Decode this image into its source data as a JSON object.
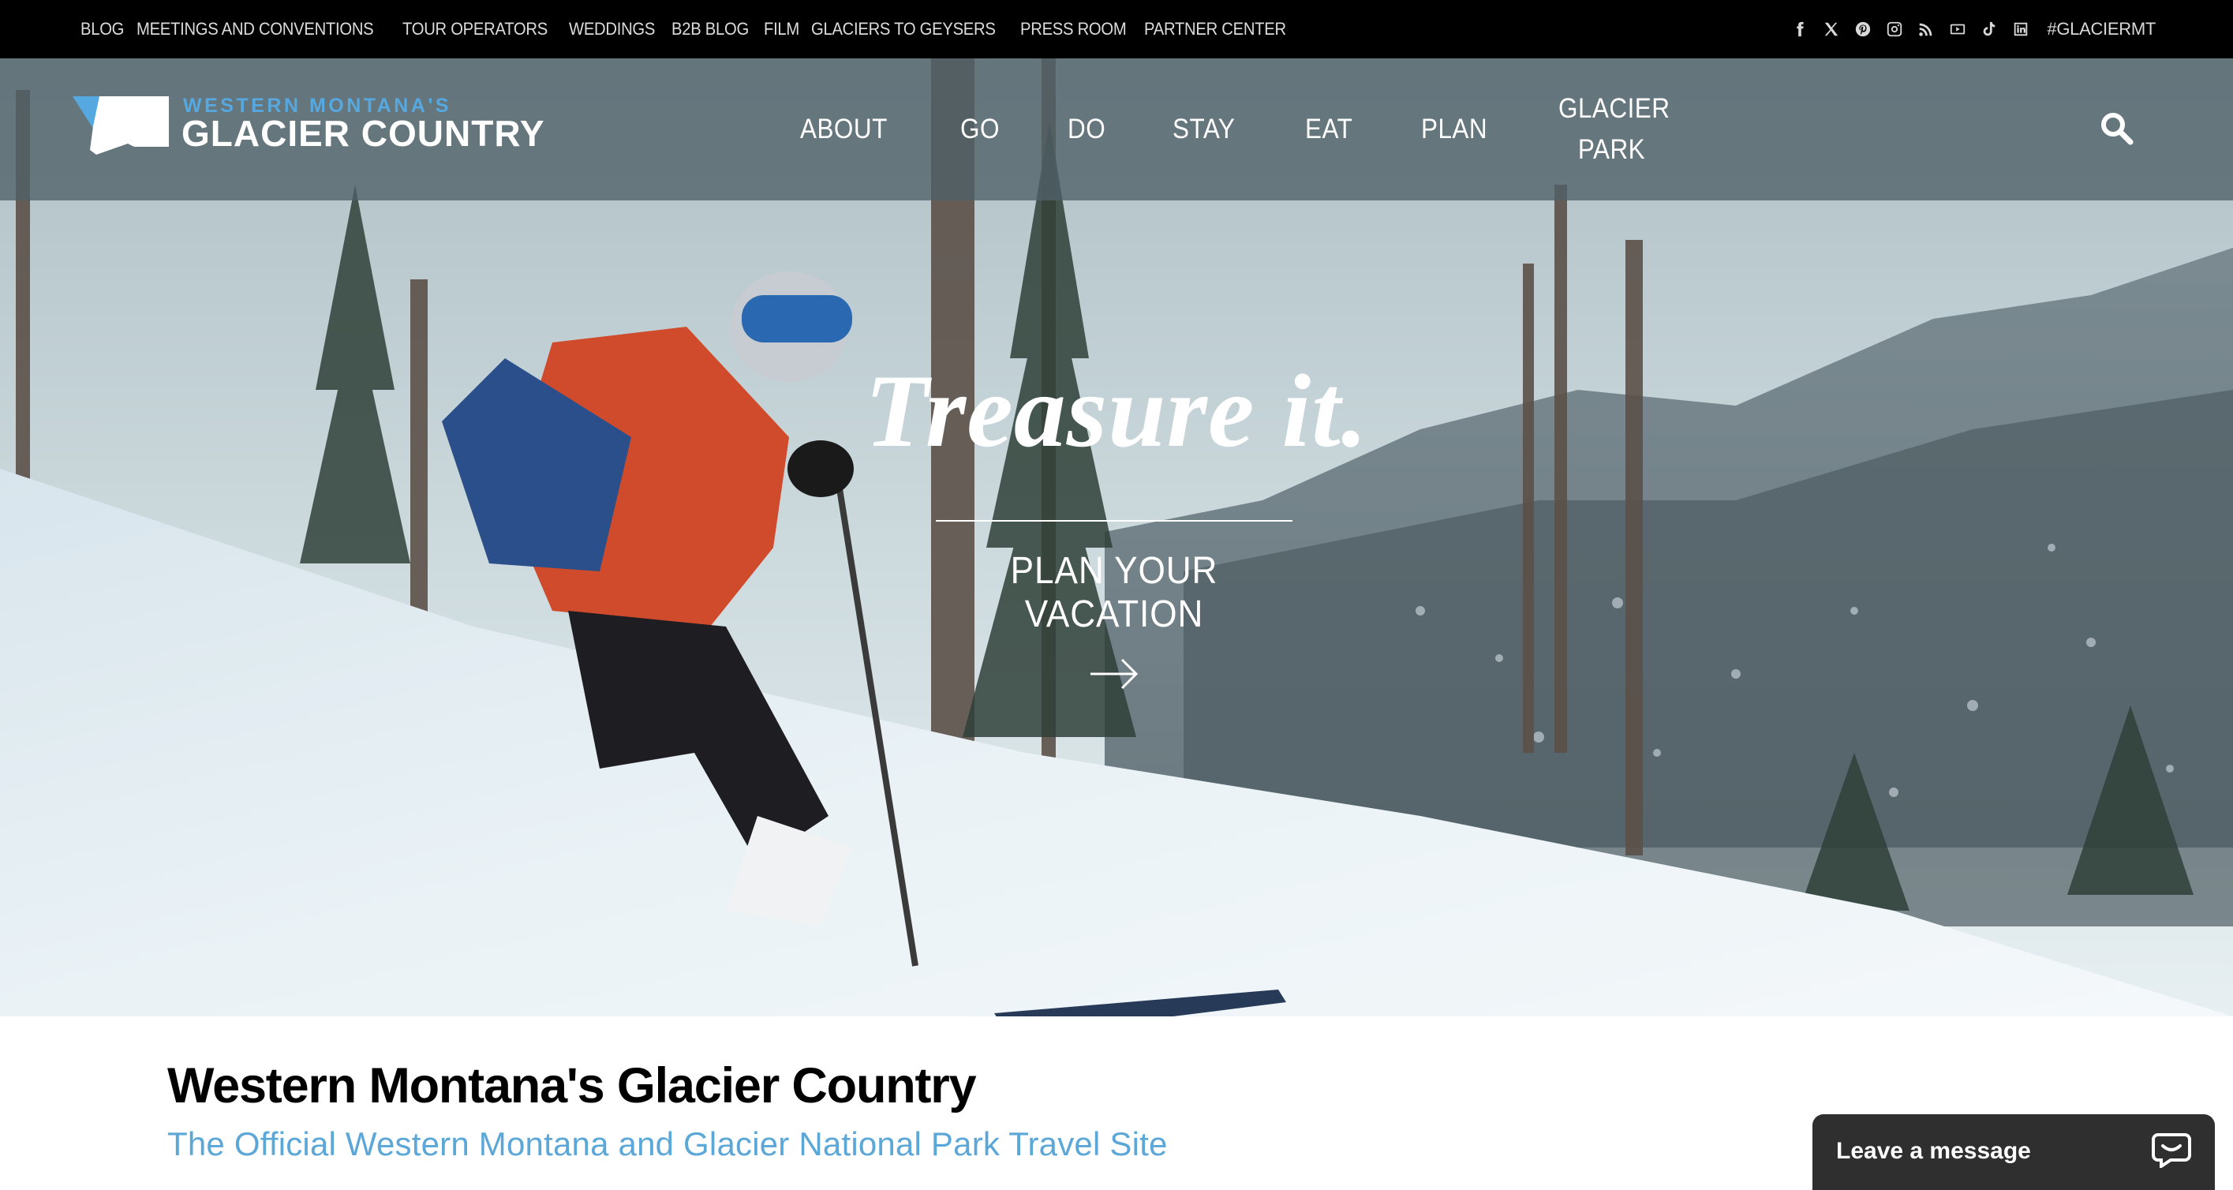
{
  "utility_bar": {
    "links": [
      "BLOG",
      "MEETINGS AND CONVENTIONS",
      "TOUR OPERATORS",
      "WEDDINGS",
      "B2B BLOG",
      "FILM",
      "GLACIERS TO GEYSERS",
      "PRESS ROOM",
      "PARTNER CENTER"
    ],
    "social_icons": [
      "facebook-icon",
      "x-icon",
      "pinterest-icon",
      "instagram-icon",
      "rss-icon",
      "youtube-icon",
      "tiktok-icon",
      "linkedin-icon"
    ],
    "hashtag": "#GLACIERMT"
  },
  "logo": {
    "top_line": "WESTERN MONTANA'S",
    "bottom_line": "GLACIER COUNTRY",
    "accent_color": "#56a9e0"
  },
  "main_nav": {
    "items": [
      "ABOUT",
      "GO",
      "DO",
      "STAY",
      "EAT",
      "PLAN"
    ],
    "glacier_park": [
      "GLACIER",
      "PARK"
    ]
  },
  "hero": {
    "headline": "Treasure it.",
    "cta_label": "PLAN YOUR VACATION",
    "cta_icon": "arrow-right-icon"
  },
  "intro": {
    "title": "Western Montana's Glacier Country",
    "subtitle": "The Official Western Montana and Glacier National Park Travel Site",
    "subtitle_color": "#5aa7d8"
  },
  "chat": {
    "label": "Leave a message",
    "icon": "chat-bubble-icon"
  }
}
